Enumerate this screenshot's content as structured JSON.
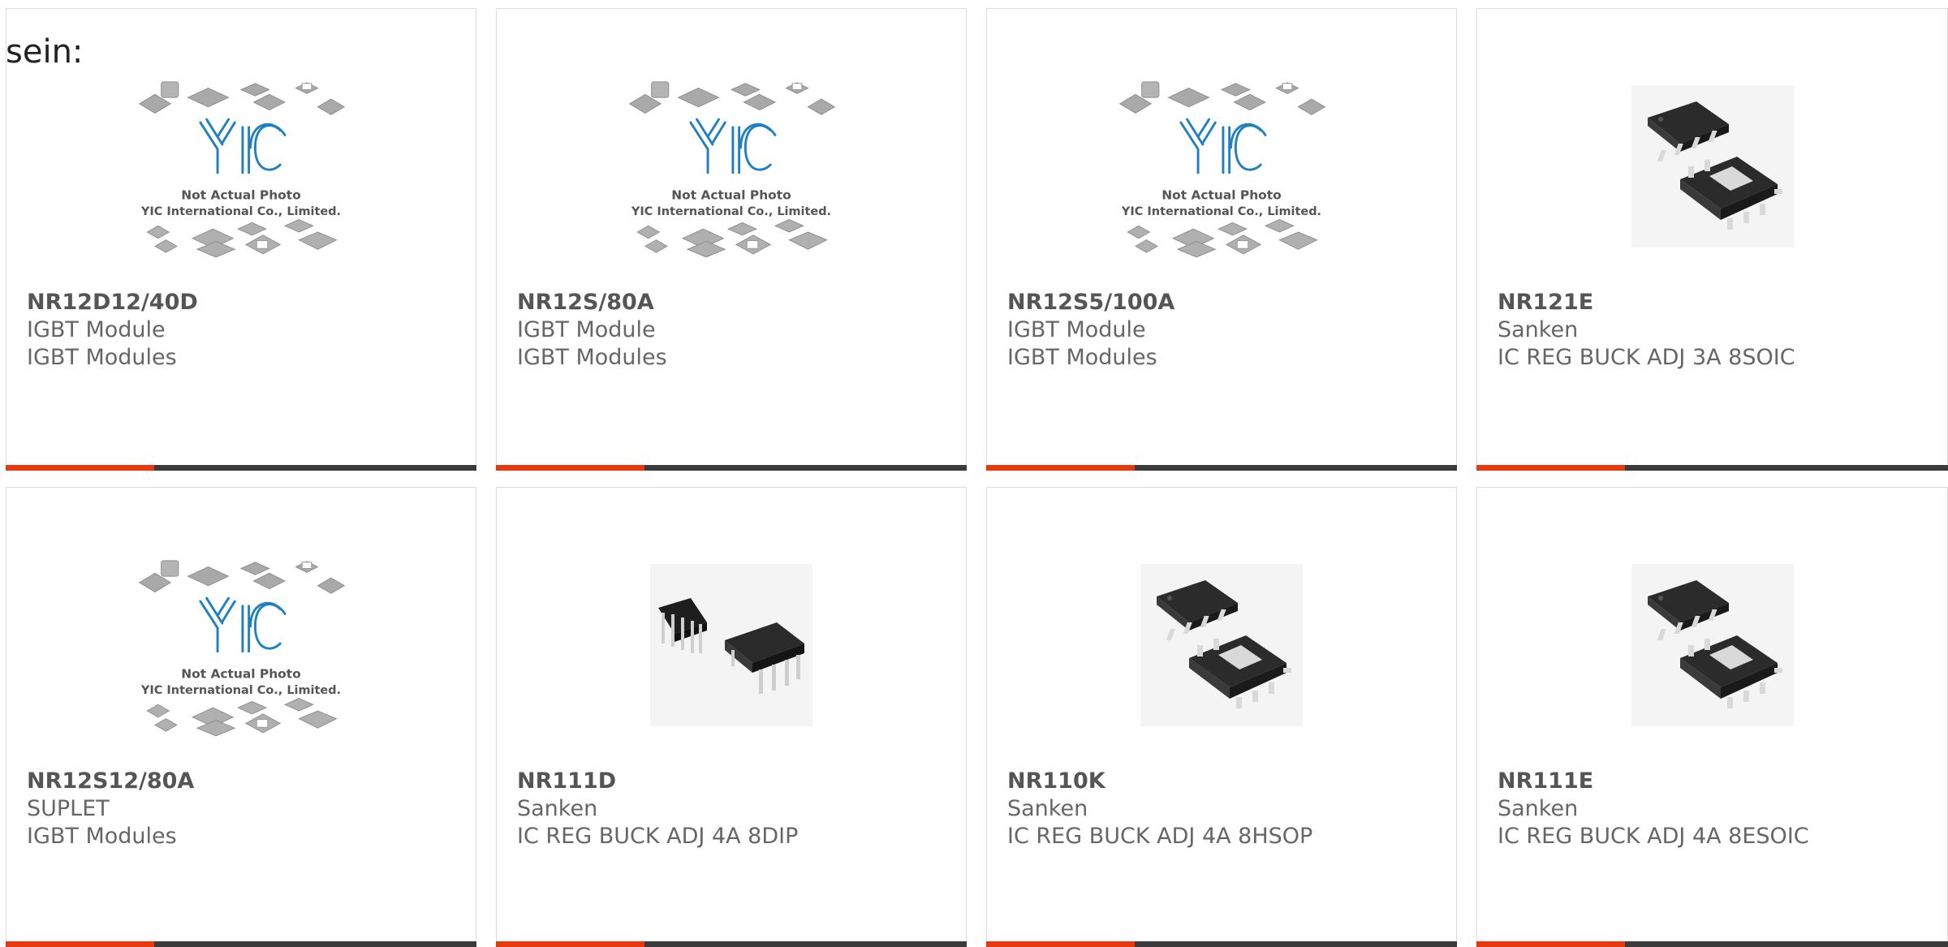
{
  "prefix": "sein:",
  "placeholder_image": {
    "line1": "Not Actual Photo",
    "line2": "YIC International Co., Limited."
  },
  "colors": {
    "accent": "#e8380d",
    "bar": "#3b3b3b",
    "border": "#dcdcdc",
    "logo": "#1e7fc3"
  },
  "products": [
    {
      "part": "NR12D12/40D",
      "maker": "IGBT Module",
      "desc": "IGBT Modules",
      "image": "placeholder-logo"
    },
    {
      "part": "NR12S/80A",
      "maker": "IGBT Module",
      "desc": "IGBT Modules",
      "image": "placeholder-logo"
    },
    {
      "part": "NR12S5/100A",
      "maker": "IGBT Module",
      "desc": "IGBT Modules",
      "image": "placeholder-logo"
    },
    {
      "part": "NR121E",
      "maker": "Sanken",
      "desc": "IC REG BUCK ADJ 3A 8SOIC",
      "image": "soic-chip"
    },
    {
      "part": "NR12S12/80A",
      "maker": "SUPLET",
      "desc": "IGBT Modules",
      "image": "placeholder-logo"
    },
    {
      "part": "NR111D",
      "maker": "Sanken",
      "desc": "IC REG BUCK ADJ 4A 8DIP",
      "image": "dip-chip"
    },
    {
      "part": "NR110K",
      "maker": "Sanken",
      "desc": "IC REG BUCK ADJ 4A 8HSOP",
      "image": "soic-chip"
    },
    {
      "part": "NR111E",
      "maker": "Sanken",
      "desc": "IC REG BUCK ADJ 4A 8ESOIC",
      "image": "soic-chip"
    }
  ]
}
